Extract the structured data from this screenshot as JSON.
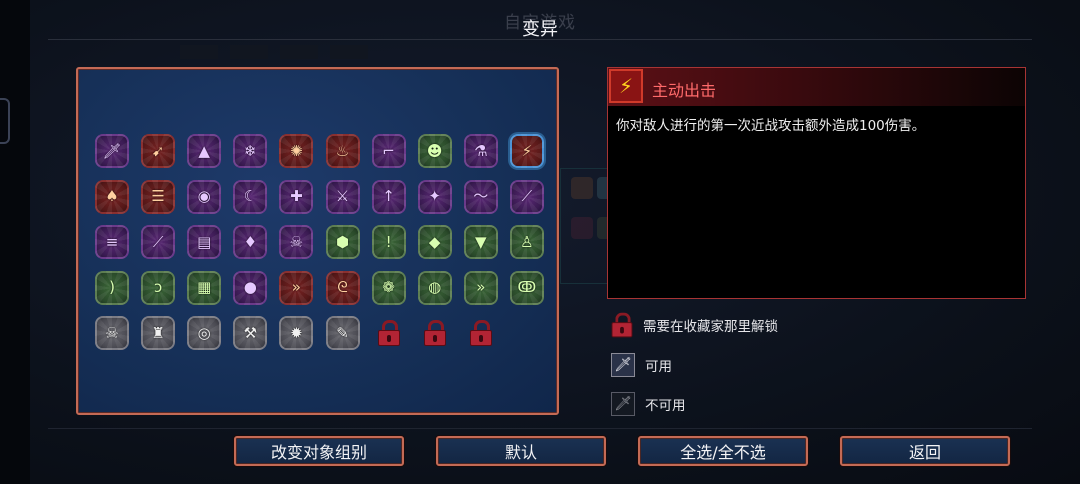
{
  "window": {
    "title": "变异",
    "ghost_title": "自定游戏"
  },
  "grid": {
    "rows": [
      [
        {
          "icon": "sword-icon",
          "glyph": "🗡",
          "frame": "purple"
        },
        {
          "icon": "crossbow-icon",
          "glyph": "➹",
          "frame": "red"
        },
        {
          "icon": "tent-icon",
          "glyph": "▲",
          "frame": "purple"
        },
        {
          "icon": "ice-blade-icon",
          "glyph": "❄",
          "frame": "purple"
        },
        {
          "icon": "red-rune-icon",
          "glyph": "✺",
          "frame": "red"
        },
        {
          "icon": "bell-icon",
          "glyph": "♨",
          "frame": "red"
        },
        {
          "icon": "gun-icon",
          "glyph": "⌐",
          "frame": "purple"
        },
        {
          "icon": "demon-head-icon",
          "glyph": "☻",
          "frame": "green"
        },
        {
          "icon": "blue-potion-icon",
          "glyph": "⚗",
          "frame": "purple"
        },
        {
          "icon": "lightning-icon",
          "glyph": "⚡",
          "frame": "red",
          "selected": true
        }
      ],
      [
        {
          "icon": "mushroom-icon",
          "glyph": "♠",
          "frame": "red"
        },
        {
          "icon": "scroll-icon",
          "glyph": "☰",
          "frame": "red"
        },
        {
          "icon": "eye-icon",
          "glyph": "◉",
          "frame": "purple"
        },
        {
          "icon": "moon-icon",
          "glyph": "☾",
          "frame": "purple"
        },
        {
          "icon": "cross-icon",
          "glyph": "✚",
          "frame": "purple"
        },
        {
          "icon": "trident-icon",
          "glyph": "⚔",
          "frame": "purple"
        },
        {
          "icon": "arrow-up-icon",
          "glyph": "↑",
          "frame": "purple"
        },
        {
          "icon": "star-burst-icon",
          "glyph": "✦",
          "frame": "purple"
        },
        {
          "icon": "wave-icon",
          "glyph": "〜",
          "frame": "purple"
        },
        {
          "icon": "slash-icon",
          "glyph": "⟋",
          "frame": "purple"
        }
      ],
      [
        {
          "icon": "gun-blue-icon",
          "glyph": "≡",
          "frame": "purple"
        },
        {
          "icon": "spear-icon",
          "glyph": "⟋",
          "frame": "purple"
        },
        {
          "icon": "tome-icon",
          "glyph": "▤",
          "frame": "purple"
        },
        {
          "icon": "gem-icon",
          "glyph": "♦",
          "frame": "purple"
        },
        {
          "icon": "skull-cross-icon",
          "glyph": "☠",
          "frame": "purple"
        },
        {
          "icon": "shield-icon",
          "glyph": "⬢",
          "frame": "green"
        },
        {
          "icon": "exclamation-icon",
          "glyph": "!",
          "frame": "green"
        },
        {
          "icon": "green-gem-icon",
          "glyph": "◆",
          "frame": "green"
        },
        {
          "icon": "fangs-icon",
          "glyph": "▼",
          "frame": "green"
        },
        {
          "icon": "red-flask-icon",
          "glyph": "♙",
          "frame": "green"
        }
      ],
      [
        {
          "icon": "bow-icon",
          "glyph": ")",
          "frame": "green"
        },
        {
          "icon": "hook-icon",
          "glyph": "ↄ",
          "frame": "green"
        },
        {
          "icon": "cage-icon",
          "glyph": "▦",
          "frame": "green"
        },
        {
          "icon": "fire-orb-icon",
          "glyph": "●",
          "frame": "purple"
        },
        {
          "icon": "double-chevron-icon",
          "glyph": "»",
          "frame": "red"
        },
        {
          "icon": "spiral-icon",
          "glyph": "ᘓ",
          "frame": "red"
        },
        {
          "icon": "swirl-icon",
          "glyph": "❁",
          "frame": "green"
        },
        {
          "icon": "fruit-icon",
          "glyph": "◍",
          "frame": "green"
        },
        {
          "icon": "yellow-chevron-icon",
          "glyph": "»",
          "frame": "green"
        },
        {
          "icon": "green-claw-icon",
          "glyph": "ↂ",
          "frame": "green"
        }
      ],
      [
        {
          "icon": "skull-icon",
          "glyph": "☠",
          "frame": "grey"
        },
        {
          "icon": "fountain-icon",
          "glyph": "♜",
          "frame": "grey"
        },
        {
          "icon": "purple-eye-icon",
          "glyph": "◎",
          "frame": "grey"
        },
        {
          "icon": "axe-icon",
          "glyph": "⚒",
          "frame": "grey"
        },
        {
          "icon": "sun-burst-icon",
          "glyph": "✹",
          "frame": "grey"
        },
        {
          "icon": "claw-icon",
          "glyph": "✎",
          "frame": "grey"
        },
        {
          "icon": "lock-icon",
          "locked": true
        },
        {
          "icon": "lock-icon",
          "locked": true
        },
        {
          "icon": "lock-icon",
          "locked": true
        }
      ]
    ]
  },
  "description": {
    "icon": "lightning-icon",
    "glyph": "⚡",
    "name": "主动出击",
    "text": "你对敌人进行的第一次近战攻击额外造成100伤害。"
  },
  "legend": {
    "locked_label": "需要在收藏家那里解锁",
    "available_label": "可用",
    "unavailable_label": "不可用"
  },
  "buttons": {
    "change_group": "改变对象组别",
    "default": "默认",
    "select_all": "全选/全不选",
    "back": "返回"
  },
  "colors": {
    "panel_border": "#c46a55",
    "panel_bg": "#163058",
    "desc_title": "#ff6a6a",
    "selected_border": "#4c93d6"
  }
}
